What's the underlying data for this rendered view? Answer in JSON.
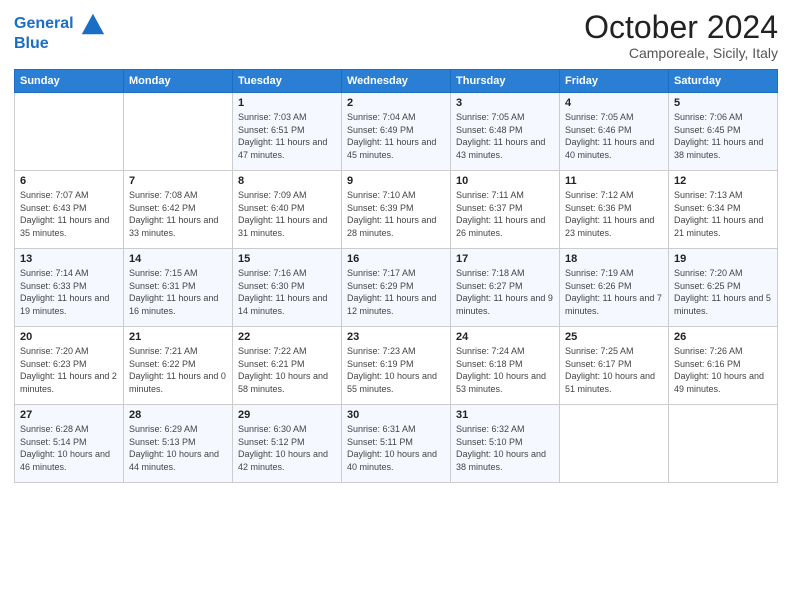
{
  "header": {
    "logo_line1": "General",
    "logo_line2": "Blue",
    "month": "October 2024",
    "location": "Camporeale, Sicily, Italy"
  },
  "days_of_week": [
    "Sunday",
    "Monday",
    "Tuesday",
    "Wednesday",
    "Thursday",
    "Friday",
    "Saturday"
  ],
  "weeks": [
    [
      {
        "day": "",
        "info": ""
      },
      {
        "day": "",
        "info": ""
      },
      {
        "day": "1",
        "info": "Sunrise: 7:03 AM\nSunset: 6:51 PM\nDaylight: 11 hours and 47 minutes."
      },
      {
        "day": "2",
        "info": "Sunrise: 7:04 AM\nSunset: 6:49 PM\nDaylight: 11 hours and 45 minutes."
      },
      {
        "day": "3",
        "info": "Sunrise: 7:05 AM\nSunset: 6:48 PM\nDaylight: 11 hours and 43 minutes."
      },
      {
        "day": "4",
        "info": "Sunrise: 7:05 AM\nSunset: 6:46 PM\nDaylight: 11 hours and 40 minutes."
      },
      {
        "day": "5",
        "info": "Sunrise: 7:06 AM\nSunset: 6:45 PM\nDaylight: 11 hours and 38 minutes."
      }
    ],
    [
      {
        "day": "6",
        "info": "Sunrise: 7:07 AM\nSunset: 6:43 PM\nDaylight: 11 hours and 35 minutes."
      },
      {
        "day": "7",
        "info": "Sunrise: 7:08 AM\nSunset: 6:42 PM\nDaylight: 11 hours and 33 minutes."
      },
      {
        "day": "8",
        "info": "Sunrise: 7:09 AM\nSunset: 6:40 PM\nDaylight: 11 hours and 31 minutes."
      },
      {
        "day": "9",
        "info": "Sunrise: 7:10 AM\nSunset: 6:39 PM\nDaylight: 11 hours and 28 minutes."
      },
      {
        "day": "10",
        "info": "Sunrise: 7:11 AM\nSunset: 6:37 PM\nDaylight: 11 hours and 26 minutes."
      },
      {
        "day": "11",
        "info": "Sunrise: 7:12 AM\nSunset: 6:36 PM\nDaylight: 11 hours and 23 minutes."
      },
      {
        "day": "12",
        "info": "Sunrise: 7:13 AM\nSunset: 6:34 PM\nDaylight: 11 hours and 21 minutes."
      }
    ],
    [
      {
        "day": "13",
        "info": "Sunrise: 7:14 AM\nSunset: 6:33 PM\nDaylight: 11 hours and 19 minutes."
      },
      {
        "day": "14",
        "info": "Sunrise: 7:15 AM\nSunset: 6:31 PM\nDaylight: 11 hours and 16 minutes."
      },
      {
        "day": "15",
        "info": "Sunrise: 7:16 AM\nSunset: 6:30 PM\nDaylight: 11 hours and 14 minutes."
      },
      {
        "day": "16",
        "info": "Sunrise: 7:17 AM\nSunset: 6:29 PM\nDaylight: 11 hours and 12 minutes."
      },
      {
        "day": "17",
        "info": "Sunrise: 7:18 AM\nSunset: 6:27 PM\nDaylight: 11 hours and 9 minutes."
      },
      {
        "day": "18",
        "info": "Sunrise: 7:19 AM\nSunset: 6:26 PM\nDaylight: 11 hours and 7 minutes."
      },
      {
        "day": "19",
        "info": "Sunrise: 7:20 AM\nSunset: 6:25 PM\nDaylight: 11 hours and 5 minutes."
      }
    ],
    [
      {
        "day": "20",
        "info": "Sunrise: 7:20 AM\nSunset: 6:23 PM\nDaylight: 11 hours and 2 minutes."
      },
      {
        "day": "21",
        "info": "Sunrise: 7:21 AM\nSunset: 6:22 PM\nDaylight: 11 hours and 0 minutes."
      },
      {
        "day": "22",
        "info": "Sunrise: 7:22 AM\nSunset: 6:21 PM\nDaylight: 10 hours and 58 minutes."
      },
      {
        "day": "23",
        "info": "Sunrise: 7:23 AM\nSunset: 6:19 PM\nDaylight: 10 hours and 55 minutes."
      },
      {
        "day": "24",
        "info": "Sunrise: 7:24 AM\nSunset: 6:18 PM\nDaylight: 10 hours and 53 minutes."
      },
      {
        "day": "25",
        "info": "Sunrise: 7:25 AM\nSunset: 6:17 PM\nDaylight: 10 hours and 51 minutes."
      },
      {
        "day": "26",
        "info": "Sunrise: 7:26 AM\nSunset: 6:16 PM\nDaylight: 10 hours and 49 minutes."
      }
    ],
    [
      {
        "day": "27",
        "info": "Sunrise: 6:28 AM\nSunset: 5:14 PM\nDaylight: 10 hours and 46 minutes."
      },
      {
        "day": "28",
        "info": "Sunrise: 6:29 AM\nSunset: 5:13 PM\nDaylight: 10 hours and 44 minutes."
      },
      {
        "day": "29",
        "info": "Sunrise: 6:30 AM\nSunset: 5:12 PM\nDaylight: 10 hours and 42 minutes."
      },
      {
        "day": "30",
        "info": "Sunrise: 6:31 AM\nSunset: 5:11 PM\nDaylight: 10 hours and 40 minutes."
      },
      {
        "day": "31",
        "info": "Sunrise: 6:32 AM\nSunset: 5:10 PM\nDaylight: 10 hours and 38 minutes."
      },
      {
        "day": "",
        "info": ""
      },
      {
        "day": "",
        "info": ""
      }
    ]
  ]
}
